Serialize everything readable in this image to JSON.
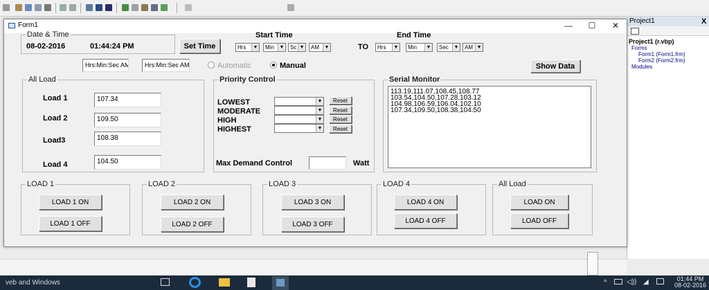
{
  "project": {
    "panel_title": "Project1",
    "close": "X",
    "tree": [
      "Project1 (r.vbp)",
      "Forms",
      "Form1 (Form1.frm)",
      "Form2 (Form2.frm)",
      "Modules"
    ]
  },
  "form": {
    "title": "Form1",
    "controls": {
      "minimize": "—",
      "maximize": "☐",
      "close": "✕"
    },
    "datetime": {
      "legend": "Date & Time",
      "date": "08-02-2016",
      "time": "01:44:24 PM"
    },
    "set_time_label": "Set Time",
    "start_time": {
      "label": "Start Time",
      "hrs": "Hrs",
      "min": "Min",
      "sec": "Sc",
      "ampm": "AM"
    },
    "to_label": "TO",
    "end_time": {
      "label": "End Time",
      "hrs": "Hrs",
      "min": "Min",
      "sec": "Sec",
      "ampm": "AM"
    },
    "start_time_box": "Hrs:Min:Sec AM",
    "end_time_box": "Hrs:Min:Sec AM",
    "mode": {
      "automatic": "Automatic",
      "manual": "Manual",
      "selected": "Manual"
    },
    "show_data_label": "Show Data",
    "all_load": {
      "legend": "All Load",
      "loads": [
        {
          "label": "Load 1",
          "value": "107.34"
        },
        {
          "label": "Load 2",
          "value": "109.50"
        },
        {
          "label": "Load3",
          "value": "108.38"
        },
        {
          "label": "Load 4",
          "value": "104.50"
        }
      ]
    },
    "priority": {
      "legend": "Priority Control",
      "levels": [
        "LOWEST",
        "MODERATE",
        "HIGH",
        "HIGHEST"
      ],
      "reset_label": "Reset",
      "max_demand_label": "Max Demand Control",
      "unit": "Watt"
    },
    "serial": {
      "legend": "Serial Monitor",
      "lines": [
        "113.19,111.07,108.45,108.77",
        "103.54,104.50,107.28,103.12",
        "104.98,106.59,106.04,102.10",
        "107.34,109.50,108.38,104.50"
      ]
    },
    "groups": [
      {
        "legend": "LOAD 1",
        "on": "LOAD 1 ON",
        "off": "LOAD 1 OFF"
      },
      {
        "legend": "LOAD 2",
        "on": "LOAD 2 ON",
        "off": "LOAD 2 OFF"
      },
      {
        "legend": "LOAD 3",
        "on": "LOAD 3 ON",
        "off": "LOAD 3 OFF"
      },
      {
        "legend": "LOAD 4",
        "on": "LOAD 4 ON",
        "off": "LOAD 4 OFF"
      },
      {
        "legend": "All Load",
        "on": "LOAD ON",
        "off": "LOAD OFF"
      }
    ]
  },
  "taskbar": {
    "search_text": "veb and Windows",
    "clock_time": "01:44 PM",
    "clock_date": "08-02-2016"
  },
  "colors": {
    "accent": "#2a6fd6",
    "taskbar": "#1b2b3c"
  }
}
